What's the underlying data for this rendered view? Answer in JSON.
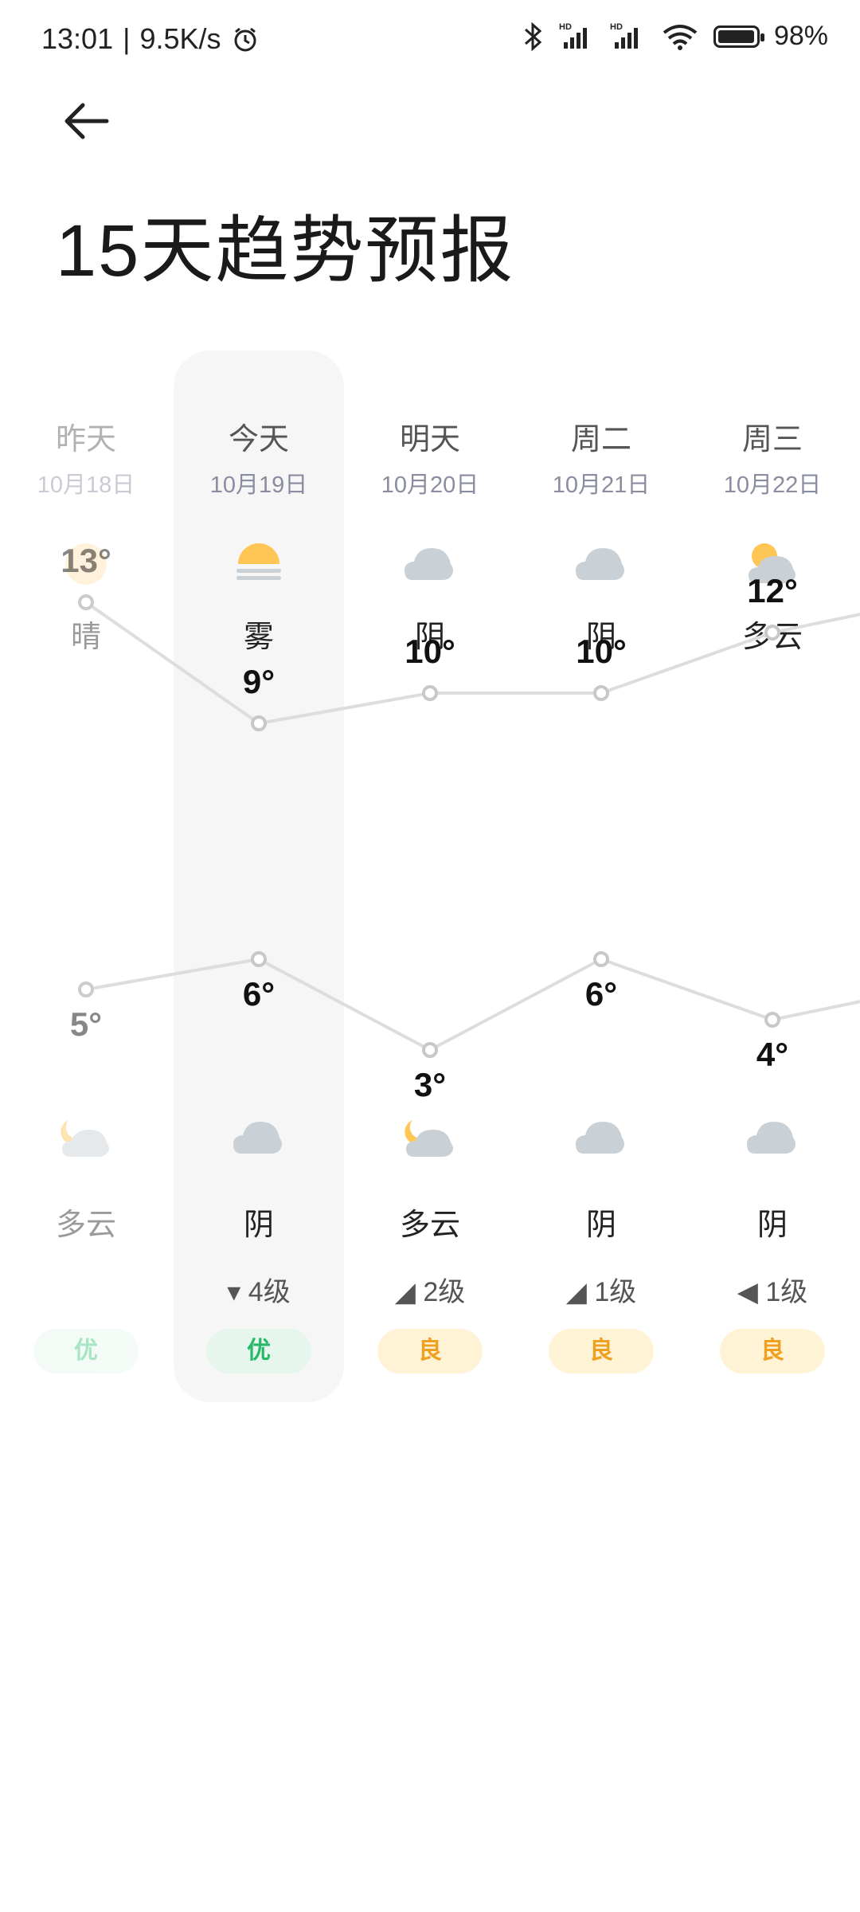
{
  "status": {
    "time": "13:01",
    "speed": "9.5K/s",
    "battery_text": "98%",
    "battery_level": 0.98,
    "net1": "HD",
    "net2": "HD"
  },
  "title": "15天趋势预报",
  "days": [
    {
      "name": "昨天",
      "date": "10月18日",
      "cond_day": "晴",
      "icon_day": "sun-icon",
      "cond_night": "多云",
      "icon_night": "partly-cloudy-night-icon",
      "wind": "",
      "aqi": "优",
      "aqi_color": "#3cc87a",
      "aqi_bg": "#e8f8ef",
      "high": "13°",
      "low": "5°"
    },
    {
      "name": "今天",
      "date": "10月19日",
      "cond_day": "雾",
      "icon_day": "fog-icon",
      "cond_night": "阴",
      "icon_night": "cloud-icon",
      "wind": "▾ 4级",
      "aqi": "优",
      "aqi_color": "#28b86a",
      "aqi_bg": "#e6f6ec",
      "high": "9°",
      "low": "6°"
    },
    {
      "name": "明天",
      "date": "10月20日",
      "cond_day": "阴",
      "icon_day": "cloud-icon",
      "cond_night": "多云",
      "icon_night": "partly-cloudy-night-icon",
      "wind": "◢ 2级",
      "aqi": "良",
      "aqi_color": "#f0a020",
      "aqi_bg": "#fff3d6",
      "high": "10°",
      "low": "3°"
    },
    {
      "name": "周二",
      "date": "10月21日",
      "cond_day": "阴",
      "icon_day": "cloud-icon",
      "cond_night": "阴",
      "icon_night": "cloud-icon",
      "wind": "◢ 1级",
      "aqi": "良",
      "aqi_color": "#f0a020",
      "aqi_bg": "#fff3d6",
      "high": "10°",
      "low": "6°"
    },
    {
      "name": "周三",
      "date": "10月22日",
      "cond_day": "多云",
      "icon_day": "partly-cloudy-icon",
      "cond_night": "阴",
      "icon_night": "cloud-icon",
      "wind": "◀ 1级",
      "aqi": "良",
      "aqi_color": "#f0a020",
      "aqi_bg": "#fff3d6",
      "high": "12°",
      "low": "4°"
    }
  ],
  "chart_data": {
    "type": "line",
    "x": [
      "昨天",
      "今天",
      "明天",
      "周二",
      "周三"
    ],
    "series": [
      {
        "values": [
          13,
          9,
          10,
          10,
          12
        ]
      },
      {
        "values": [
          5,
          6,
          3,
          6,
          4
        ]
      }
    ],
    "line_color": "#dddddd"
  }
}
